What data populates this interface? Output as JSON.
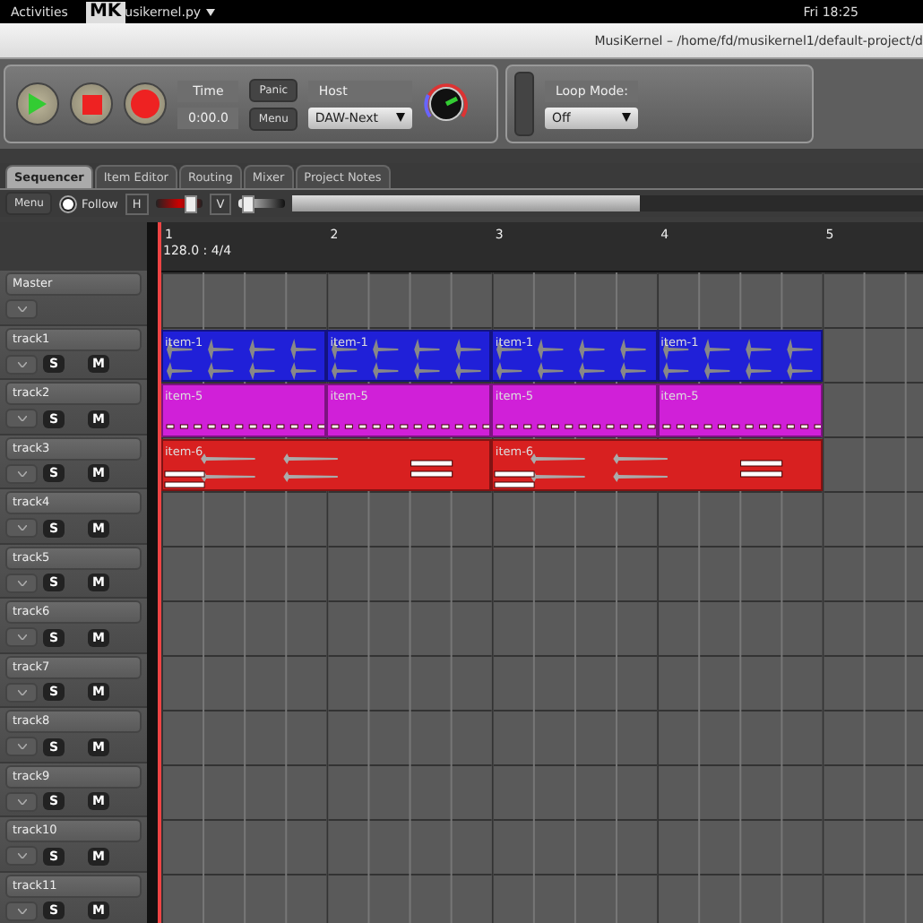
{
  "top_bar": {
    "activities": "Activities",
    "logo": "MK",
    "app_menu": "usikernel.py",
    "clock": "Fri 18:25"
  },
  "window": {
    "title": "MusiKernel – /home/fd/musikernel1/default-project/d"
  },
  "transport": {
    "time_label": "Time",
    "time_value": "0:00.0",
    "panic": "Panic",
    "menu": "Menu",
    "host_label": "Host",
    "host": "DAW-Next",
    "loop_label": "Loop Mode:",
    "loop": "Off"
  },
  "tabs": [
    {
      "label": "Sequencer",
      "selected": true
    },
    {
      "label": "Item Editor",
      "selected": false
    },
    {
      "label": "Routing",
      "selected": false
    },
    {
      "label": "Mixer",
      "selected": false
    },
    {
      "label": "Project Notes",
      "selected": false
    }
  ],
  "toolbar": {
    "menu": "Menu",
    "follow": {
      "label": "Follow",
      "checked": true
    },
    "h_label": "H",
    "h_zoom": {
      "level": 0.75
    },
    "v_label": "V",
    "v_zoom": {
      "level": 0.1
    },
    "scroll": {
      "level": 0.55
    }
  },
  "ruler": {
    "bars": [
      "1",
      "2",
      "3",
      "4",
      "5"
    ],
    "tempo": "128.0 : 4/4"
  },
  "tracks": [
    {
      "name": "Master",
      "kind": "master"
    },
    {
      "name": "track1",
      "kind": "track",
      "solo": "S",
      "mute": "M",
      "items": [
        {
          "label": "item-1",
          "kind": "audio",
          "color": "#2020d8"
        },
        {
          "label": "item-1",
          "kind": "audio",
          "color": "#2020d8"
        },
        {
          "label": "item-1",
          "kind": "audio",
          "color": "#2020d8"
        },
        {
          "label": "item-1",
          "kind": "audio",
          "color": "#2020d8"
        }
      ]
    },
    {
      "name": "track2",
      "kind": "track",
      "solo": "S",
      "mute": "M",
      "items": [
        {
          "label": "item-5",
          "kind": "notes",
          "color": "#d020d8"
        },
        {
          "label": "item-5",
          "kind": "notes",
          "color": "#d020d8"
        },
        {
          "label": "item-5",
          "kind": "notes",
          "color": "#d020d8"
        },
        {
          "label": "item-5",
          "kind": "notes",
          "color": "#d020d8"
        }
      ]
    },
    {
      "name": "track3",
      "kind": "track",
      "solo": "S",
      "mute": "M",
      "items": [
        {
          "label": "item-6",
          "kind": "mixed",
          "color": "#d82020"
        },
        {
          "label": "item-6",
          "kind": "mixed",
          "color": "#d82020"
        }
      ]
    },
    {
      "name": "track4",
      "kind": "track",
      "solo": "S",
      "mute": "M"
    },
    {
      "name": "track5",
      "kind": "track",
      "solo": "S",
      "mute": "M"
    },
    {
      "name": "track6",
      "kind": "track",
      "solo": "S",
      "mute": "M"
    },
    {
      "name": "track7",
      "kind": "track",
      "solo": "S",
      "mute": "M"
    },
    {
      "name": "track8",
      "kind": "track",
      "solo": "S",
      "mute": "M"
    },
    {
      "name": "track9",
      "kind": "track",
      "solo": "S",
      "mute": "M"
    },
    {
      "name": "track10",
      "kind": "track",
      "solo": "S",
      "mute": "M"
    },
    {
      "name": "track11",
      "kind": "track",
      "solo": "S",
      "mute": "M"
    }
  ]
}
